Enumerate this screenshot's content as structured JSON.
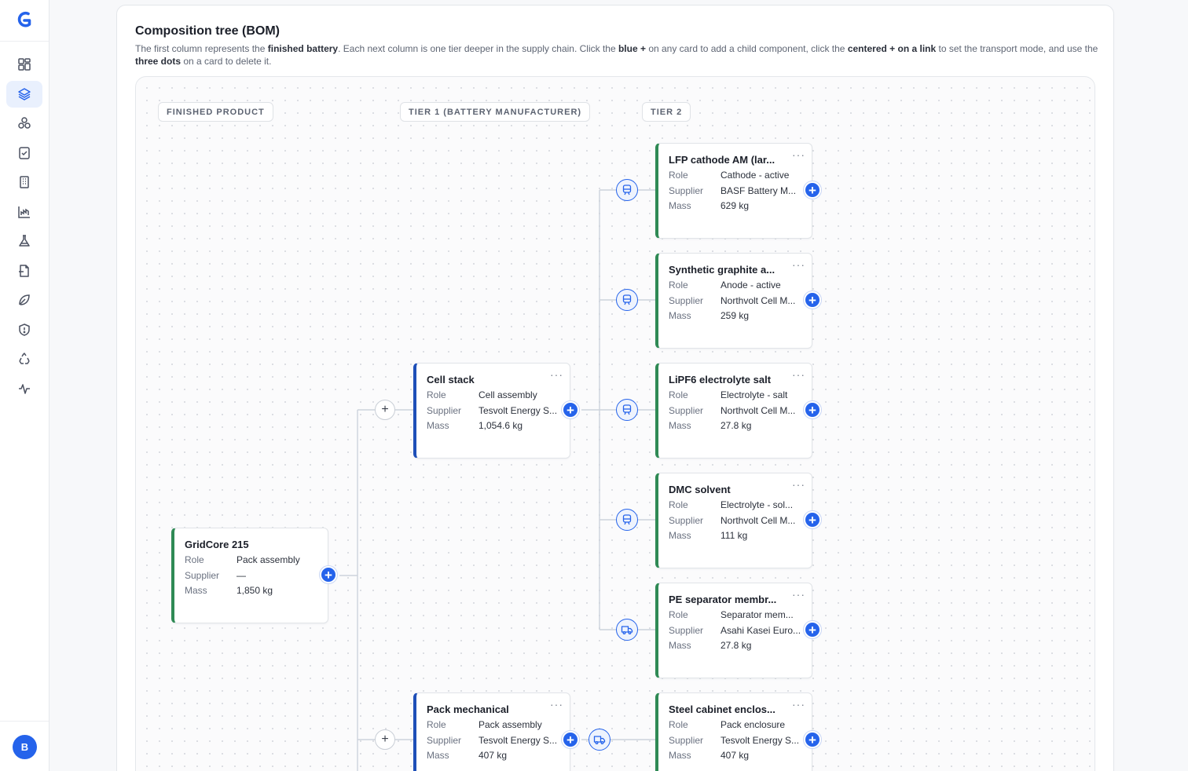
{
  "user": {
    "avatar_initial": "B"
  },
  "sidebar": {
    "items": [
      {
        "icon": "dashboard-icon"
      },
      {
        "icon": "layers-icon",
        "active": true
      },
      {
        "icon": "molecule-icon"
      },
      {
        "icon": "clipboard-check-icon"
      },
      {
        "icon": "building-icon"
      },
      {
        "icon": "factory-chart-icon"
      },
      {
        "icon": "flask-icon"
      },
      {
        "icon": "document-icon"
      },
      {
        "icon": "leaf-icon"
      },
      {
        "icon": "shield-icon"
      },
      {
        "icon": "recycle-icon"
      },
      {
        "icon": "activity-icon"
      }
    ]
  },
  "page": {
    "title": "Composition tree (BOM)",
    "desc_1": "The first column represents the ",
    "desc_b1": "finished battery",
    "desc_2": ". Each next column is one tier deeper in the supply chain. Click the ",
    "desc_b2": "blue +",
    "desc_3": " on any card to add a child component, click the ",
    "desc_b3": "centered + on a link",
    "desc_4": " to set the transport mode, and use the ",
    "desc_b4": "three dots",
    "desc_5": " on a card to delete it."
  },
  "columns": [
    "FINISHED PRODUCT",
    "TIER 1 (BATTERY MANUFACTURER)",
    "TIER 2"
  ],
  "labels": {
    "role": "Role",
    "supplier": "Supplier",
    "mass": "Mass"
  },
  "cards": {
    "root": {
      "name": "GridCore 215",
      "role": "Pack assembly",
      "supplier": "—",
      "mass": "1,850 kg"
    },
    "cell_stack": {
      "name": "Cell stack",
      "role": "Cell assembly",
      "supplier": "Tesvolt Energy S...",
      "mass": "1,054.6 kg"
    },
    "pack_mech": {
      "name": "Pack mechanical",
      "role": "Pack assembly",
      "supplier": "Tesvolt Energy S...",
      "mass": "407 kg"
    },
    "lfp": {
      "name": "LFP cathode AM (lar...",
      "role": "Cathode - active",
      "supplier": "BASF Battery M...",
      "mass": "629 kg"
    },
    "graphite": {
      "name": "Synthetic graphite a...",
      "role": "Anode - active",
      "supplier": "Northvolt Cell M...",
      "mass": "259 kg"
    },
    "lipf6": {
      "name": "LiPF6 electrolyte salt",
      "role": "Electrolyte - salt",
      "supplier": "Northvolt Cell M...",
      "mass": "27.8 kg"
    },
    "dmc": {
      "name": "DMC solvent",
      "role": "Electrolyte - sol...",
      "supplier": "Northvolt Cell M...",
      "mass": "111 kg"
    },
    "pe": {
      "name": "PE separator membr...",
      "role": "Separator mem...",
      "supplier": "Asahi Kasei Euro...",
      "mass": "27.8 kg"
    },
    "steel": {
      "name": "Steel cabinet enclos...",
      "role": "Pack enclosure",
      "supplier": "Tesvolt Energy S...",
      "mass": "407 kg"
    }
  },
  "buttons": {
    "add": "+",
    "link_add": "+",
    "more": "···"
  },
  "colors": {
    "accent": "#2563eb",
    "finished_border": "#2f8a55",
    "tier1_border": "#1e4fb8"
  }
}
